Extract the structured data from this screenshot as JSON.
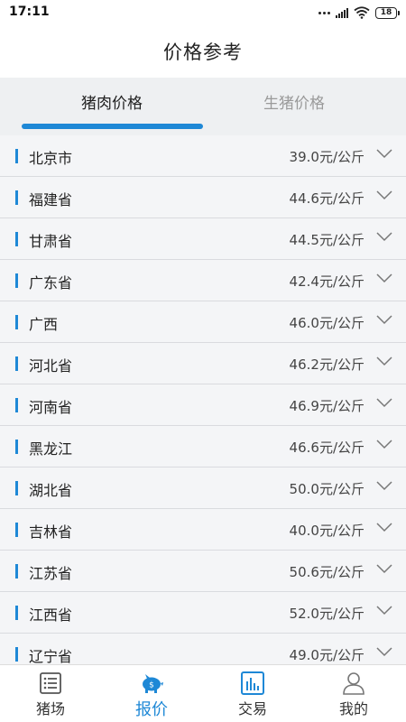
{
  "status_bar": {
    "time": "17:11",
    "battery": "18"
  },
  "header": {
    "title": "价格参考"
  },
  "tabs": [
    {
      "label": "猪肉价格",
      "active": true
    },
    {
      "label": "生猪价格",
      "active": false
    }
  ],
  "price_list": [
    {
      "region": "北京市",
      "price": "39.0元/公斤"
    },
    {
      "region": "福建省",
      "price": "44.6元/公斤"
    },
    {
      "region": "甘肃省",
      "price": "44.5元/公斤"
    },
    {
      "region": "广东省",
      "price": "42.4元/公斤"
    },
    {
      "region": "广西",
      "price": "46.0元/公斤"
    },
    {
      "region": "河北省",
      "price": "46.2元/公斤"
    },
    {
      "region": "河南省",
      "price": "46.9元/公斤"
    },
    {
      "region": "黑龙江",
      "price": "46.6元/公斤"
    },
    {
      "region": "湖北省",
      "price": "50.0元/公斤"
    },
    {
      "region": "吉林省",
      "price": "40.0元/公斤"
    },
    {
      "region": "江苏省",
      "price": "50.6元/公斤"
    },
    {
      "region": "江西省",
      "price": "52.0元/公斤"
    },
    {
      "region": "辽宁省",
      "price": "49.0元/公斤"
    }
  ],
  "bottom_nav": [
    {
      "label": "猪场",
      "icon": "list-icon",
      "active": false
    },
    {
      "label": "报价",
      "icon": "piggy-bank-icon",
      "active": true
    },
    {
      "label": "交易",
      "icon": "bar-chart-icon",
      "active": false
    },
    {
      "label": "我的",
      "icon": "user-icon",
      "active": false
    }
  ],
  "colors": {
    "accent": "#1e88d6",
    "background": "#f4f5f7",
    "tab_background": "#eef0f2"
  }
}
